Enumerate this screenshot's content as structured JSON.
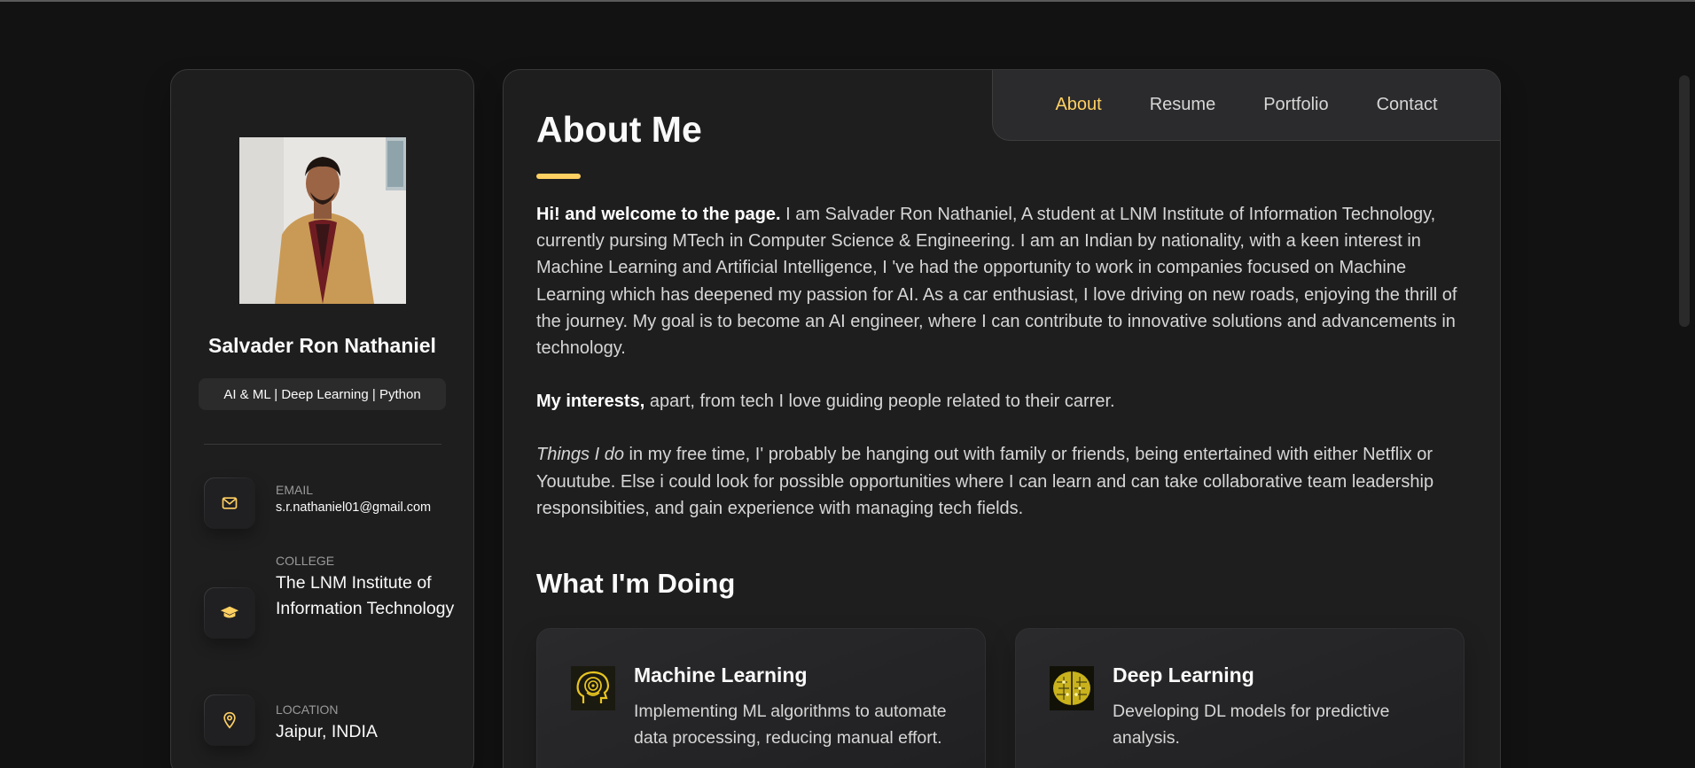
{
  "sidebar": {
    "name": "Salvader Ron Nathaniel",
    "title": "AI & ML | Deep Learning | Python",
    "contacts": [
      {
        "label": "Email",
        "value": "s.r.nathaniel01@gmail.com",
        "icon": "mail-icon"
      },
      {
        "label": "College",
        "value": "The LNM Institute of Information Technology",
        "icon": "graduation-cap-icon"
      },
      {
        "label": "Location",
        "value": "Jaipur, INDIA",
        "icon": "location-pin-icon"
      }
    ]
  },
  "navbar": {
    "items": [
      "About",
      "Resume",
      "Portfolio",
      "Contact"
    ],
    "active": "About"
  },
  "about": {
    "title": "About Me",
    "p1_bold": "Hi! and welcome to the page.",
    "p1_text": " I am Salvader Ron Nathaniel, A student at LNM Institute of Information Technology, currently pursing MTech in Computer Science & Engineering. I am an Indian by nationality, with a keen interest in Machine Learning and Artificial Intelligence, I 've had the opportunity to work in companies focused on Machine Learning which has deepened my passion for AI. As a car enthusiast, I love driving on new roads, enjoying the thrill of the journey. My goal is to become an AI engineer, where I can contribute to innovative solutions and advancements in technology.",
    "p2_bold": "My interests,",
    "p2_text": " apart, from tech I love guiding people related to their carrer.",
    "p3_italic": "Things I do",
    "p3_text": " in my free time, I' probably be hanging out with family or friends, being entertained with either Netflix or Youutube. Else i could look for possible opportunities where I can learn and can take collaborative team leadership responsibities, and gain experience with managing tech fields."
  },
  "services": {
    "title": "What I'm Doing",
    "items": [
      {
        "title": "Machine Learning",
        "text": "Implementing ML algorithms to automate data processing, reducing manual effort.",
        "icon": "ai-head-icon"
      },
      {
        "title": "Deep Learning",
        "text": "Developing DL models for predictive analysis.",
        "icon": "brain-circuit-icon"
      }
    ]
  },
  "colors": {
    "accent": "#ffd062",
    "background": "#121212",
    "card": "#1e1e1f"
  }
}
